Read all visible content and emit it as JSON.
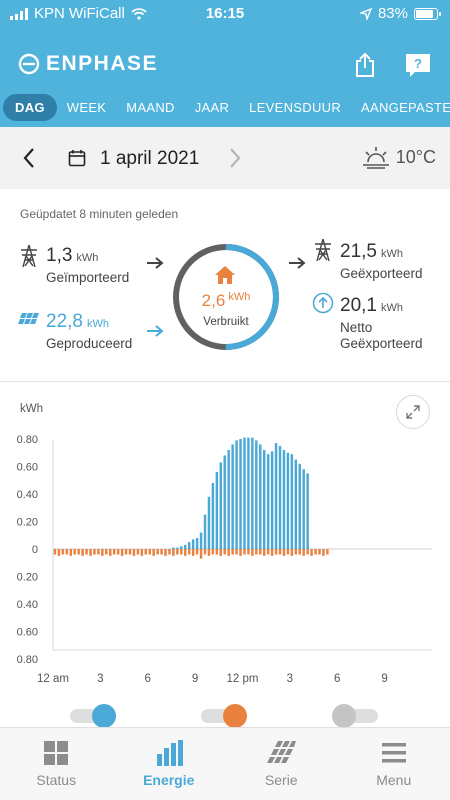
{
  "status_bar": {
    "carrier": "KPN WiFiCall",
    "time": "16:15",
    "battery": "83%",
    "battery_level": 0.83
  },
  "header": {
    "brand": "ENPHASE"
  },
  "tabs": [
    {
      "label": "DAG",
      "active": true
    },
    {
      "label": "WEEK",
      "active": false
    },
    {
      "label": "MAAND",
      "active": false
    },
    {
      "label": "JAAR",
      "active": false
    },
    {
      "label": "LEVENSDUUR",
      "active": false
    },
    {
      "label": "AANGEPASTE",
      "active": false
    }
  ],
  "date_nav": {
    "date": "1 april 2021",
    "temperature": "10°C"
  },
  "summary": {
    "updated": "Geüpdatet 8 minuten geleden",
    "imported": {
      "value": "1,3",
      "unit": "kWh",
      "label": "Geïmporteerd"
    },
    "produced": {
      "value": "22,8",
      "unit": "kWh",
      "label": "Geproduceerd"
    },
    "consumed": {
      "value": "2,6",
      "unit": "kWh",
      "label": "Verbruikt"
    },
    "exported": {
      "value": "21,5",
      "unit": "kWh",
      "label": "Geëxporteerd"
    },
    "net_exported": {
      "value": "20,1",
      "unit": "kWh",
      "label_line1": "Netto",
      "label_line2": "Geëxporteerd"
    }
  },
  "chart_data": {
    "type": "bar",
    "ylabel": "kWh",
    "y_ticks_positive": [
      "0.80",
      "0.60",
      "0.40",
      "0.20"
    ],
    "y_zero": "0",
    "y_ticks_negative": [
      "0.20",
      "0.40",
      "0.60",
      "0.80"
    ],
    "ylim": [
      -0.8,
      0.8
    ],
    "x_tick_labels": [
      "12 am",
      "3",
      "6",
      "9",
      "12 pm",
      "3",
      "6",
      "9"
    ],
    "x_tick_hours": [
      0,
      3,
      6,
      9,
      12,
      15,
      18,
      21
    ],
    "interval_hours": 0.25,
    "series": [
      {
        "name": "production",
        "color": "#4aa9d6",
        "start_hour": 7.5,
        "values": [
          0.01,
          0.01,
          0.02,
          0.03,
          0.05,
          0.07,
          0.08,
          0.12,
          0.25,
          0.38,
          0.48,
          0.56,
          0.63,
          0.68,
          0.72,
          0.76,
          0.79,
          0.8,
          0.81,
          0.81,
          0.81,
          0.79,
          0.76,
          0.72,
          0.69,
          0.71,
          0.77,
          0.75,
          0.72,
          0.7,
          0.69,
          0.65,
          0.62,
          0.58,
          0.55
        ]
      },
      {
        "name": "consumption",
        "color": "#e8823e",
        "start_hour": 0,
        "values": [
          -0.04,
          -0.05,
          -0.04,
          -0.04,
          -0.05,
          -0.04,
          -0.04,
          -0.05,
          -0.04,
          -0.05,
          -0.04,
          -0.04,
          -0.05,
          -0.04,
          -0.05,
          -0.04,
          -0.04,
          -0.05,
          -0.04,
          -0.04,
          -0.05,
          -0.04,
          -0.05,
          -0.04,
          -0.04,
          -0.05,
          -0.04,
          -0.04,
          -0.05,
          -0.04,
          -0.05,
          -0.04,
          -0.04,
          -0.05,
          -0.04,
          -0.05,
          -0.04,
          -0.07,
          -0.04,
          -0.05,
          -0.04,
          -0.04,
          -0.05,
          -0.04,
          -0.05,
          -0.04,
          -0.04,
          -0.05,
          -0.04,
          -0.04,
          -0.05,
          -0.04,
          -0.04,
          -0.05,
          -0.04,
          -0.05,
          -0.04,
          -0.04,
          -0.05,
          -0.04,
          -0.05,
          -0.04,
          -0.04,
          -0.05,
          -0.04,
          -0.05,
          -0.04,
          -0.04,
          -0.05,
          -0.04
        ]
      }
    ]
  },
  "toggles": [
    {
      "name": "production",
      "color": "#4aa9d6",
      "on": true
    },
    {
      "name": "consumption",
      "color": "#e8823e",
      "on": true
    },
    {
      "name": "other",
      "color": "#c4c4c4",
      "on": false
    }
  ],
  "bottom_nav": [
    {
      "label": "Status",
      "icon": "grid-icon",
      "active": false
    },
    {
      "label": "Energie",
      "icon": "bar-chart-icon",
      "active": true
    },
    {
      "label": "Serie",
      "icon": "solar-panel-icon",
      "active": false
    },
    {
      "label": "Menu",
      "icon": "menu-icon",
      "active": false
    }
  ]
}
